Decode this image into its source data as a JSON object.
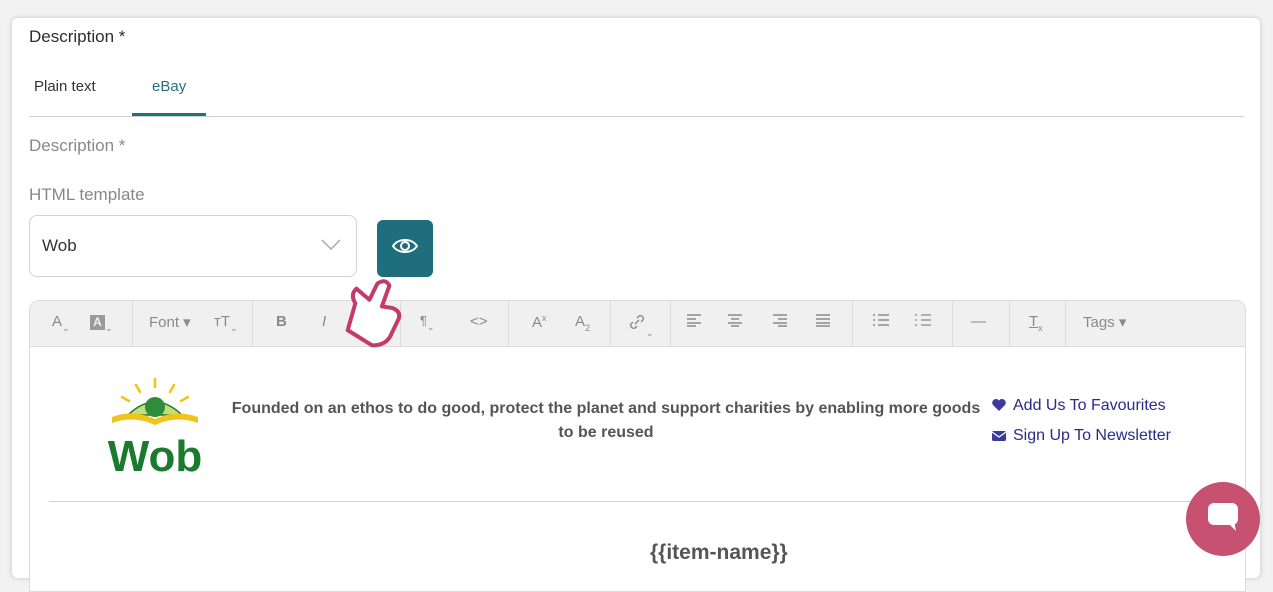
{
  "form": {
    "section_title": "Description *",
    "tabs": [
      {
        "label": "Plain text",
        "active": false
      },
      {
        "label": "eBay",
        "active": true
      }
    ],
    "description_label": "Description *",
    "html_template_label": "HTML template",
    "template_select_value": "Wob"
  },
  "toolbar": {
    "font_color": "A",
    "background_color": "A",
    "font_label": "Font",
    "font_size": "тT",
    "bold": "B",
    "italic": "I",
    "paragraph": "¶",
    "code": "<>",
    "superscript": "A",
    "subscript": "A",
    "link": "🔗",
    "horizontal_rule": "—",
    "clear_format": "T",
    "tags_label": "Tags"
  },
  "template_content": {
    "logo_text": "Wob",
    "tagline": "Founded on an ethos to do good, protect the planet and support charities by enabling more goods to be reused",
    "favourites_link": "Add Us To Favourites",
    "newsletter_link": "Sign Up To Newsletter",
    "item_name_placeholder": "{{item-name}}"
  },
  "colors": {
    "accent": "#1e6e7d",
    "chat_button": "#c65171",
    "link": "#2a2a8a",
    "logo_green": "#1a7a2e"
  },
  "icons": {
    "preview": "eye-icon",
    "select": "chevron-down-icon",
    "chat": "chat-bubble-icon",
    "favourites": "heart-icon",
    "newsletter": "envelope-icon",
    "pointer": "hand-pointer-icon"
  }
}
